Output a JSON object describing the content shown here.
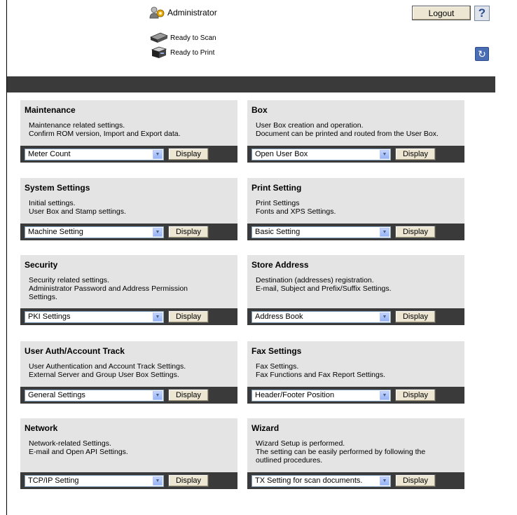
{
  "header": {
    "user": "Administrator",
    "logout_label": "Logout",
    "help_label": "?",
    "status_scan": "Ready to Scan",
    "status_print": "Ready to Print"
  },
  "cards": [
    {
      "title": "Maintenance",
      "desc": "Maintenance related settings.\nConfirm ROM version, Import and Export data.",
      "select": "Meter Count",
      "button": "Display"
    },
    {
      "title": "Box",
      "desc": "User Box creation and operation.\nDocument can be printed and routed from the User Box.",
      "select": "Open User Box",
      "button": "Display"
    },
    {
      "title": "System Settings",
      "desc": "Initial settings.\nUser Box and Stamp settings.",
      "select": "Machine Setting",
      "button": "Display"
    },
    {
      "title": "Print Setting",
      "desc": "Print Settings\nFonts and XPS Settings.",
      "select": "Basic Setting",
      "button": "Display"
    },
    {
      "title": "Security",
      "desc": "Security related settings.\nAdministrator Password and Address Permission\nSettings.",
      "select": "PKI Settings",
      "button": "Display"
    },
    {
      "title": "Store Address",
      "desc": "Destination (addresses) registration.\nE-mail, Subject and Prefix/Suffix Settings.",
      "select": "Address Book",
      "button": "Display"
    },
    {
      "title": "User Auth/Account Track",
      "desc": "User Authentication and Account Track Settings.\nExternal Server and Group User Box Settings.",
      "select": "General Settings",
      "button": "Display"
    },
    {
      "title": "Fax Settings",
      "desc": "Fax Settings.\nFax Functions and Fax Report Settings.",
      "select": "Header/Footer Position",
      "button": "Display"
    },
    {
      "title": "Network",
      "desc": "Network-related Settings.\nE-mail and Open API Settings.",
      "select": "TCP/IP Setting",
      "button": "Display"
    },
    {
      "title": "Wizard",
      "desc": "Wizard Setup is performed.\nThe setting can be easily performed by following the\noutlined procedures.",
      "select": "TX Setting for scan documents.",
      "button": "Display"
    }
  ]
}
